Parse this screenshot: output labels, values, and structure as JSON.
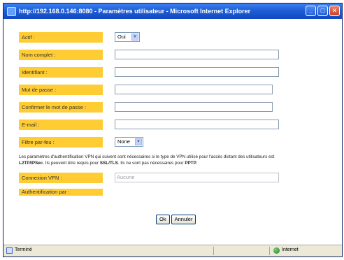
{
  "window": {
    "title": "http://192.168.0.146:8080 - Paramètres utilisateur - Microsoft Internet Explorer",
    "minimize_glyph": "_",
    "maximize_glyph": "□",
    "close_glyph": "✕"
  },
  "form": {
    "actif_label": "Actif :",
    "actif_value": "Oui",
    "nom_label": "Nom complet :",
    "nom_value": "",
    "identifiant_label": "Identifiant :",
    "identifiant_value": "",
    "mdp_label": "Mot de passe :",
    "mdp_value": "",
    "confirm_label": "Confirmer le mot de passe :",
    "confirm_value": "",
    "email_label": "E-mail :",
    "email_value": "",
    "filtre_label": "Filtre par-feu :",
    "filtre_value": "None",
    "note_part1": "Les paramètres d'authentification VPN qui suivent sont nécessaires si le type de VPN utilisé pour l'accès distant des utilisateurs est",
    "note_bold1": "L2TP/IPSec",
    "note_part2": ". Ils peuvent être requis pour",
    "note_bold2": "SSL/TLS",
    "note_part3": ". Ils ne sont pas nécessaires pour",
    "note_bold3": "PPTP",
    "note_part4": ".",
    "vpn_label": "Connexion VPN :",
    "vpn_value": "Aucune",
    "auth_label": "Authentification par :"
  },
  "buttons": {
    "ok": "Ok",
    "cancel": "Annuler"
  },
  "status": {
    "text": "Terminé",
    "zone": "Internet"
  },
  "colors": {
    "label_bg": "#ffcc33",
    "titlebar": "#1f5fd6"
  }
}
